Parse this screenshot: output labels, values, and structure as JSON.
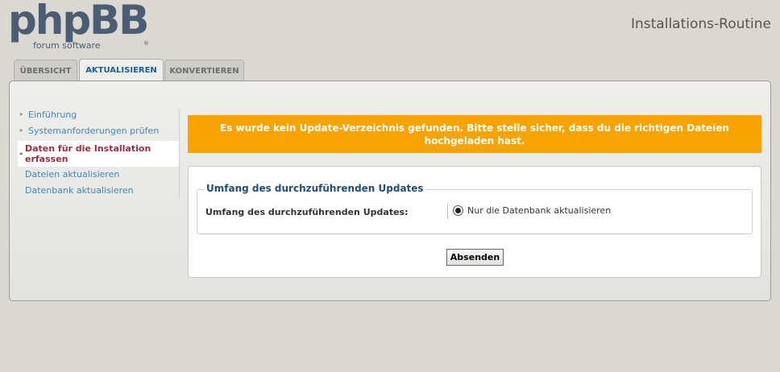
{
  "logo": {
    "word": "phpBB",
    "subtitle": "forum software",
    "reg": "®"
  },
  "header": {
    "title": "Installations-Routine"
  },
  "tabs": [
    {
      "label": "ÜBERSICHT"
    },
    {
      "label": "AKTUALISIEREN",
      "active": true
    },
    {
      "label": "KONVERTIEREN"
    }
  ],
  "menu": {
    "items": [
      {
        "label": "Einführung"
      },
      {
        "label": "Systemanforderungen prüfen"
      },
      {
        "label": "Daten für die Installation erfassen",
        "active": true
      },
      {
        "label": "Dateien aktualisieren"
      },
      {
        "label": "Datenbank aktualisieren"
      }
    ]
  },
  "error": {
    "message": "Es wurde kein Update-Verzeichnis gefunden. Bitte stelle sicher, dass du die richtigen Dateien hochgeladen hast."
  },
  "form": {
    "legend": "Umfang des durchzuführenden Updates",
    "field_label": "Umfang des durchzuführenden Updates:",
    "radio_label": "Nur die Datenbank aktualisieren",
    "submit_label": "Absenden"
  },
  "colors": {
    "accent": "#1a5f9c",
    "warning": "#f9a300",
    "active_menu": "#a32a3f"
  }
}
